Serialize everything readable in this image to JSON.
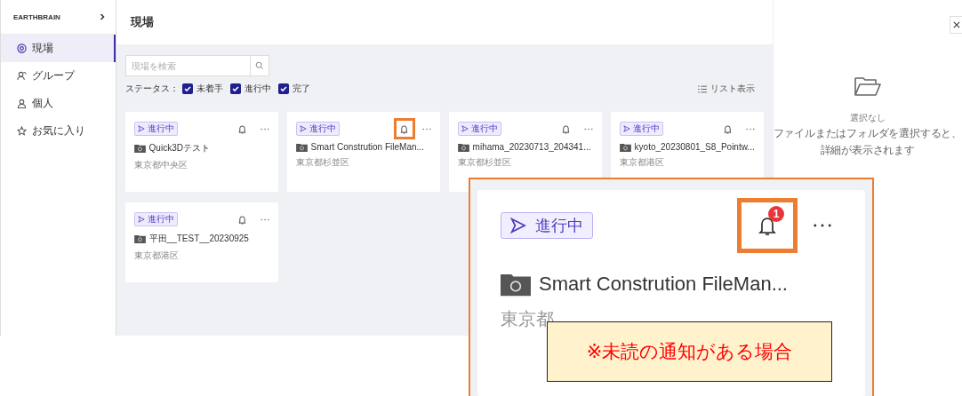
{
  "sidebar": {
    "brand": "EARTHBRAIN",
    "items": [
      {
        "label": "現場",
        "selected": true
      },
      {
        "label": "グループ",
        "selected": false
      },
      {
        "label": "個人",
        "selected": false
      },
      {
        "label": "お気に入り",
        "selected": false
      }
    ]
  },
  "header": {
    "title": "現場"
  },
  "toolbar": {
    "search": {
      "placeholder": "現場を検索"
    },
    "status_label": "ステータス：",
    "filters": [
      {
        "label": "未着手",
        "checked": true
      },
      {
        "label": "進行中",
        "checked": true
      },
      {
        "label": "完了",
        "checked": true
      }
    ],
    "view_toggle": "リスト表示"
  },
  "cards": [
    {
      "status": "進行中",
      "title": "Quick3Dテスト",
      "address": "東京都中央区",
      "highlighted": false
    },
    {
      "status": "進行中",
      "title": "Smart Constrution FileMan...",
      "address": "東京都杉並区",
      "highlighted": true
    },
    {
      "status": "進行中",
      "title": "mihama_20230713_204341...",
      "address": "東京都杉並区",
      "highlighted": false
    },
    {
      "status": "進行中",
      "title": "kyoto_20230801_S8_Pointw...",
      "address": "東京都港区",
      "highlighted": false
    },
    {
      "status": "進行中",
      "title": "平田__TEST__20230925",
      "address": "東京都港区",
      "highlighted": false
    }
  ],
  "detail_panel": {
    "title": "選択なし",
    "description": [
      "ファイルまたはフォルダを選択すると、",
      "詳細が表示されます"
    ]
  },
  "callout": {
    "status": "進行中",
    "badge": "1",
    "title": "Smart Constrution FileMan...",
    "address": "東京都",
    "note": "※未読の通知がある場合"
  }
}
